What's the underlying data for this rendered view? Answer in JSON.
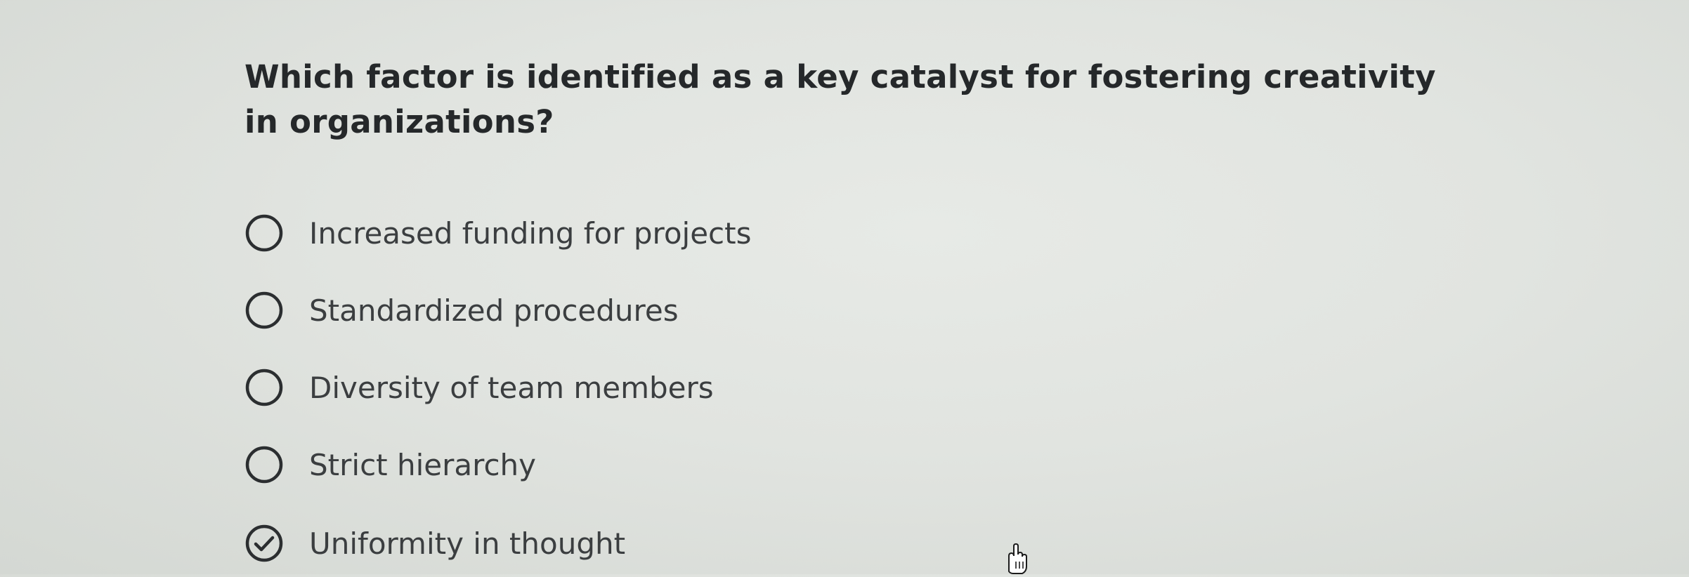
{
  "question": {
    "text": "Which factor is identified as a key catalyst for fostering creativity in organizations?"
  },
  "options": [
    {
      "label": "Increased funding for projects",
      "selected": false,
      "icon": "radio-unchecked-icon"
    },
    {
      "label": "Standardized procedures",
      "selected": false,
      "icon": "radio-unchecked-icon"
    },
    {
      "label": "Diversity of team members",
      "selected": false,
      "icon": "radio-unchecked-icon"
    },
    {
      "label": "Strict hierarchy",
      "selected": false,
      "icon": "radio-unchecked-icon"
    },
    {
      "label": "Uniformity in thought",
      "selected": true,
      "icon": "radio-checked-icon"
    }
  ],
  "colors": {
    "background": "#e1e4e0",
    "text": "#25282a",
    "radio_stroke": "#2b2e30"
  },
  "cursor": {
    "icon": "hand-pointer-icon"
  }
}
